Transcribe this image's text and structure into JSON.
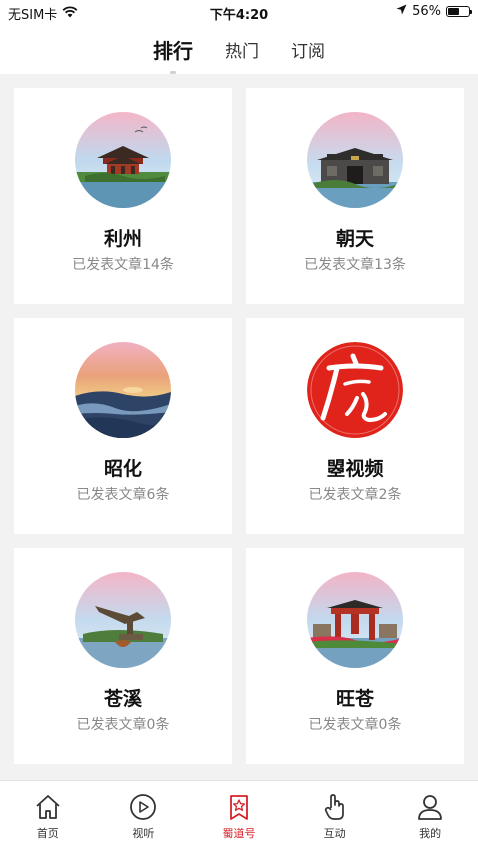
{
  "status_bar": {
    "carrier": "无SIM卡",
    "time": "下午4:20",
    "battery": "56%",
    "battery_level": 0.56
  },
  "tabs": [
    {
      "label": "排行",
      "active": true
    },
    {
      "label": "热门",
      "active": false
    },
    {
      "label": "订阅",
      "active": false
    }
  ],
  "cards": [
    {
      "name": "利州",
      "subtitle": "已发表文章14条",
      "icon": "pavilion-icon"
    },
    {
      "name": "朝天",
      "subtitle": "已发表文章13条",
      "icon": "gate-icon"
    },
    {
      "name": "昭化",
      "subtitle": "已发表文章6条",
      "icon": "sunset-river-icon"
    },
    {
      "name": "曌视频",
      "subtitle": "已发表文章2条",
      "icon": "calligraphy-seal-icon",
      "seal_text": "广元"
    },
    {
      "name": "苍溪",
      "subtitle": "已发表文章0条",
      "icon": "statue-icon"
    },
    {
      "name": "旺苍",
      "subtitle": "已发表文章0条",
      "icon": "archway-icon"
    }
  ],
  "bottom_nav": [
    {
      "label": "首页",
      "icon": "home-icon",
      "active": false
    },
    {
      "label": "视听",
      "icon": "play-icon",
      "active": false
    },
    {
      "label": "蜀道号",
      "icon": "bookmark-star-icon",
      "active": true
    },
    {
      "label": "互动",
      "icon": "hand-touch-icon",
      "active": false
    },
    {
      "label": "我的",
      "icon": "user-icon",
      "active": false
    }
  ],
  "colors": {
    "accent": "#d6222a",
    "background": "#f2f2f2",
    "card": "#ffffff",
    "subtitle": "#888888"
  }
}
